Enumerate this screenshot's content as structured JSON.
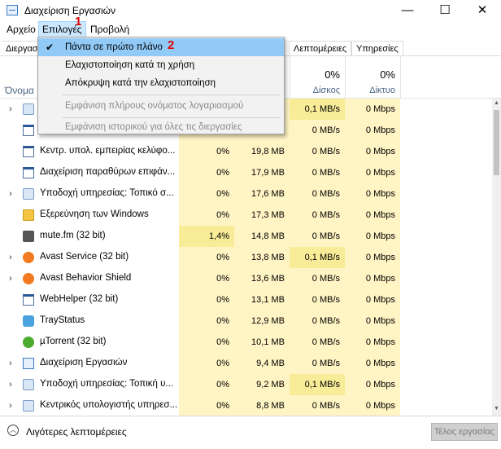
{
  "window": {
    "title": "Διαχείριση Εργασιών",
    "minimize": "—",
    "maximize": "☐",
    "close": "✕"
  },
  "menubar": {
    "items": [
      "Αρχείο",
      "Επιλογές",
      "Προβολή"
    ]
  },
  "tabs": [
    "Διεργασ",
    "Λεπτομέρειες",
    "Υπηρεσίες"
  ],
  "columns": {
    "name": "Όνομα",
    "disk": {
      "percent": "0%",
      "label": "Δίσκος"
    },
    "network": {
      "percent": "0%",
      "label": "Δίκτυο"
    }
  },
  "options_menu": {
    "always_on_top": "Πάντα σε πρώτο πλάνο",
    "minimize_on_use": "Ελαχιστοποίηση κατά τη χρήση",
    "hide_when_minimized": "Απόκρυψη κατά την ελαχιστοποίηση",
    "show_full_account_name": "Εμφάνιση πλήρους ονόματος λογαριασμού",
    "show_history_all": "Εμφάνιση ιστορικού για όλες τις διεργασίες"
  },
  "annotations": {
    "one": "1",
    "two": "2"
  },
  "processes": [
    {
      "name": "",
      "cpu": "",
      "memory": "",
      "disk": "0,1 MB/s",
      "network": "0 Mbps",
      "expandable": true,
      "icon": "gear-icon"
    },
    {
      "name": "",
      "cpu": "",
      "memory": "",
      "disk": "0 MB/s",
      "network": "0 Mbps",
      "expandable": false,
      "icon": "window-icon"
    },
    {
      "name": "Κεντρ. υπολ. εμπειρίας κελύφο...",
      "cpu": "0%",
      "memory": "19,8 MB",
      "disk": "0 MB/s",
      "network": "0 Mbps",
      "expandable": false,
      "icon": "window-icon"
    },
    {
      "name": "Διαχείριση παραθύρων επιφάν...",
      "cpu": "0%",
      "memory": "17,9 MB",
      "disk": "0 MB/s",
      "network": "0 Mbps",
      "expandable": false,
      "icon": "window-icon"
    },
    {
      "name": "Υποδοχή υπηρεσίας: Τοπικό σ...",
      "cpu": "0%",
      "memory": "17,6 MB",
      "disk": "0 MB/s",
      "network": "0 Mbps",
      "expandable": true,
      "icon": "gear-icon"
    },
    {
      "name": "Εξερεύνηση των Windows",
      "cpu": "0%",
      "memory": "17,3 MB",
      "disk": "0 MB/s",
      "network": "0 Mbps",
      "expandable": false,
      "icon": "folder-icon"
    },
    {
      "name": "mute.fm (32 bit)",
      "cpu": "1,4%",
      "memory": "14,8 MB",
      "disk": "0 MB/s",
      "network": "0 Mbps",
      "expandable": false,
      "icon": "speaker-icon"
    },
    {
      "name": "Avast Service (32 bit)",
      "cpu": "0%",
      "memory": "13,8 MB",
      "disk": "0,1 MB/s",
      "network": "0 Mbps",
      "expandable": true,
      "icon": "avast-icon"
    },
    {
      "name": "Avast Behavior Shield",
      "cpu": "0%",
      "memory": "13,6 MB",
      "disk": "0 MB/s",
      "network": "0 Mbps",
      "expandable": true,
      "icon": "avast-icon"
    },
    {
      "name": "WebHelper (32 bit)",
      "cpu": "0%",
      "memory": "13,1 MB",
      "disk": "0 MB/s",
      "network": "0 Mbps",
      "expandable": false,
      "icon": "window-icon"
    },
    {
      "name": "TrayStatus",
      "cpu": "0%",
      "memory": "12,9 MB",
      "disk": "0 MB/s",
      "network": "0 Mbps",
      "expandable": false,
      "icon": "traystatus-icon"
    },
    {
      "name": "µTorrent (32 bit)",
      "cpu": "0%",
      "memory": "10,1 MB",
      "disk": "0 MB/s",
      "network": "0 Mbps",
      "expandable": false,
      "icon": "utorrent-icon"
    },
    {
      "name": "Διαχείριση Εργασιών",
      "cpu": "0%",
      "memory": "9,4 MB",
      "disk": "0 MB/s",
      "network": "0 Mbps",
      "expandable": true,
      "icon": "taskmanager-icon"
    },
    {
      "name": "Υποδοχή υπηρεσίας: Τοπική υ...",
      "cpu": "0%",
      "memory": "9,2 MB",
      "disk": "0,1 MB/s",
      "network": "0 Mbps",
      "expandable": true,
      "icon": "gear-icon"
    },
    {
      "name": "Κεντρικός υπολογιστής υπηρεσ...",
      "cpu": "0%",
      "memory": "8,8 MB",
      "disk": "0 MB/s",
      "network": "0 Mbps",
      "expandable": true,
      "icon": "gear-icon"
    }
  ],
  "footer": {
    "fewer_details": "Λιγότερες λεπτομέρειες",
    "end_task": "Τέλος εργασίας"
  }
}
